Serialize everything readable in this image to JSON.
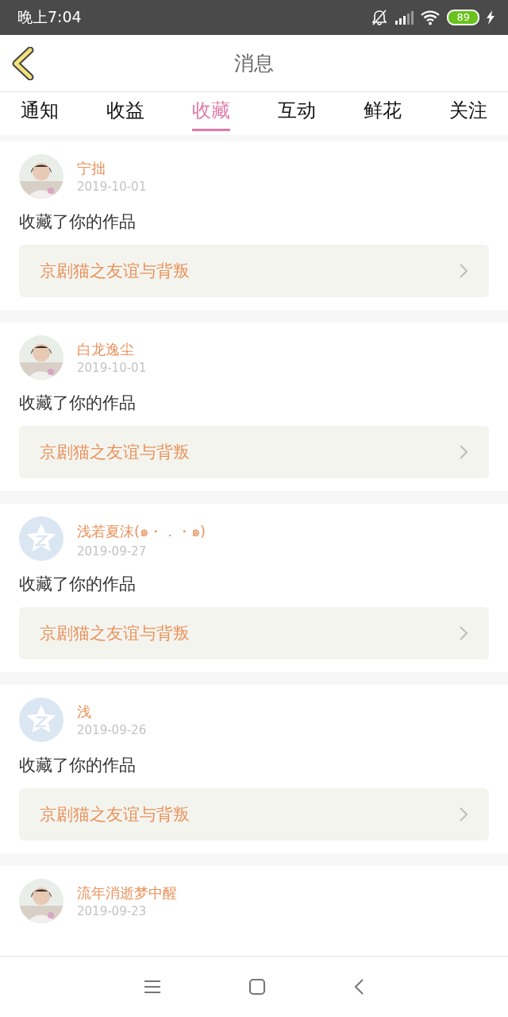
{
  "status_bar": {
    "time": "晚上7:04",
    "battery": "89"
  },
  "header": {
    "title": "消息"
  },
  "tabs": [
    {
      "label": "通知",
      "selected": false
    },
    {
      "label": "收益",
      "selected": false
    },
    {
      "label": "收藏",
      "selected": true
    },
    {
      "label": "互动",
      "selected": false
    },
    {
      "label": "鲜花",
      "selected": false
    },
    {
      "label": "关注",
      "selected": false
    }
  ],
  "messages": [
    {
      "kind": "picture",
      "name": "宁拙",
      "date": "2019-10-01",
      "action": "收藏了你的作品",
      "work": "京剧猫之友谊与背叛"
    },
    {
      "kind": "picture",
      "name": "白龙逸尘",
      "date": "2019-10-01",
      "action": "收藏了你的作品",
      "work": "京剧猫之友谊与背叛"
    },
    {
      "kind": "default_avatar",
      "name": "浅若夏沫(๑・．・๑)",
      "date": "2019-09-27",
      "action": "收藏了你的作品",
      "work": "京剧猫之友谊与背叛"
    },
    {
      "kind": "default_avatar",
      "name": "浅",
      "date": "2019-09-26",
      "action": "收藏了你的作品",
      "work": "京剧猫之友谊与背叛"
    },
    {
      "kind": "picture",
      "name": "流年消逝梦中醒",
      "date": "2019-09-23"
    }
  ]
}
